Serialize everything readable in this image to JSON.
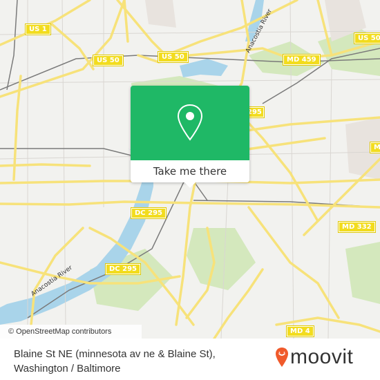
{
  "map": {
    "attribution": "© OpenStreetMap contributors",
    "shields": [
      {
        "label": "US 1"
      },
      {
        "label": "US 50"
      },
      {
        "label": "US 50"
      },
      {
        "label": "US 50"
      },
      {
        "label": "MD 459"
      },
      {
        "label": "295"
      },
      {
        "label": "DC 295"
      },
      {
        "label": "DC 295"
      },
      {
        "label": "MD 332"
      },
      {
        "label": "MD"
      },
      {
        "label": "MD 4"
      }
    ],
    "river_labels": [
      "Anacostia River",
      "Anacostia River"
    ],
    "colors": {
      "road": "#f7e27a",
      "water": "#a9d4ea",
      "park": "#cfe5b5",
      "land": "#f2f2ef"
    }
  },
  "popup": {
    "icon": "location-pin-icon",
    "action_label": "Take me there",
    "color": "#1fb866"
  },
  "footer": {
    "title_line1": "Blaine St NE (minnesota av ne & Blaine St),",
    "title_line2": "Washington / Baltimore",
    "logo_text": "moovit",
    "logo_color": "#f05a2b"
  }
}
